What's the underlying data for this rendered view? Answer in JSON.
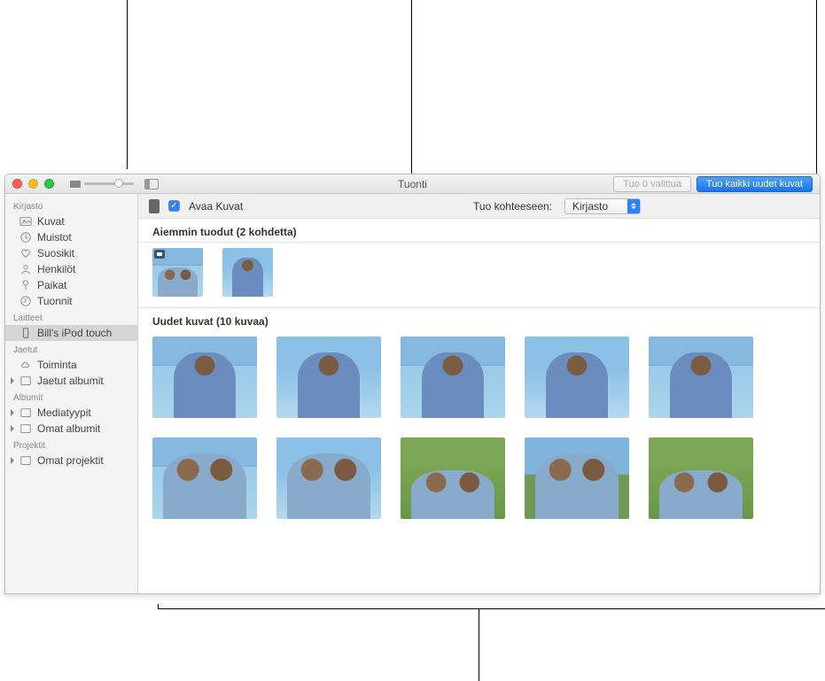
{
  "window": {
    "title": "Tuonti",
    "import_selected_label": "Tuo 0 valittua",
    "import_all_label": "Tuo kaikki uudet kuvat"
  },
  "sidebar": {
    "sections": {
      "library": "Kirjasto",
      "devices": "Laitteet",
      "shared": "Jaetut",
      "albums": "Albumit",
      "projects": "Projektit"
    },
    "items": {
      "photos": "Kuvat",
      "memories": "Muistot",
      "favorites": "Suosikit",
      "people": "Henkilöt",
      "places": "Paikat",
      "imports": "Tuonnit",
      "device": "Bill's iPod touch",
      "activity": "Toiminta",
      "shared_albums": "Jaetut albumit",
      "media_types": "Mediatyypit",
      "my_albums": "Omat albumit",
      "my_projects": "Omat projektit"
    }
  },
  "import_bar": {
    "open_photos": "Avaa Kuvat",
    "import_to_label": "Tuo kohteeseen:",
    "destination": "Kirjasto"
  },
  "sections": {
    "already": "Aiemmin tuodut (2 kohdetta)",
    "new": "Uudet kuvat (10 kuvaa)"
  }
}
